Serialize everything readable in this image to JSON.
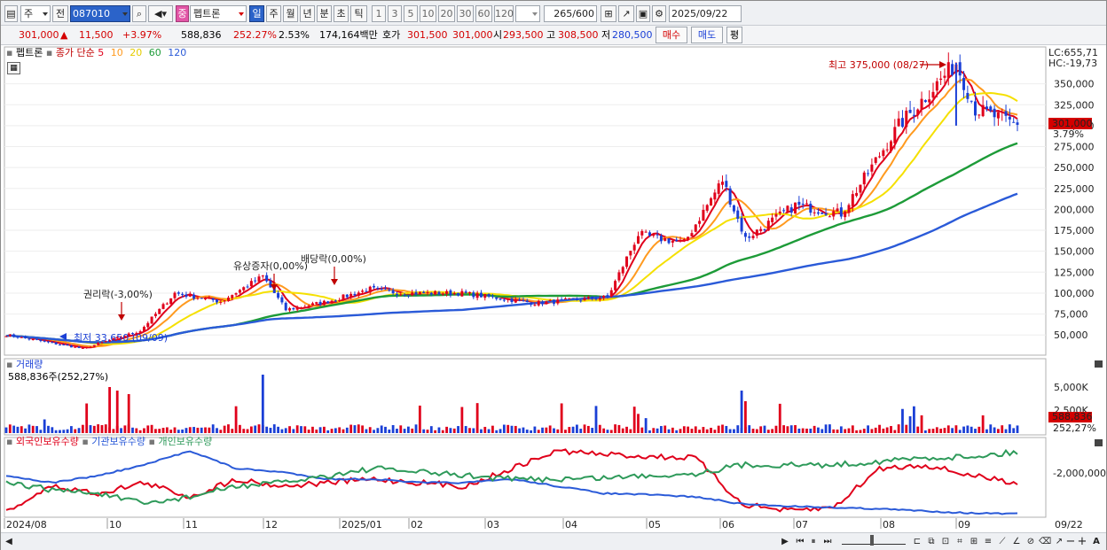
{
  "toolbar": {
    "mode_label": "주",
    "prev_label": "전",
    "stock_code": "087010",
    "stock_badge": "중",
    "stock_name": "펩트론",
    "periods": [
      "일",
      "주",
      "월",
      "년",
      "분",
      "초",
      "틱"
    ],
    "active_period": "일",
    "intervals": [
      "1",
      "3",
      "5",
      "10",
      "20",
      "30",
      "60",
      "120"
    ],
    "count_value": "265",
    "count_total": "/600",
    "date_value": "2025/09/22"
  },
  "quote": {
    "price": "301,000",
    "change_arrow": "▲",
    "change": "11,500",
    "change_pct": "+3.97%",
    "volume": "588,836",
    "volume_ratio": "252.27%",
    "turnover": "2.53%",
    "amount": "174,164백만",
    "ask_label": "호가",
    "ask1": "301,500",
    "ask2": "301,000",
    "open_label": "시",
    "open": "293,500",
    "high_label": "고",
    "high": "308,500",
    "low_label": "저",
    "low": "280,500",
    "buy_label": "매수",
    "sell_label": "매도",
    "eval_label": "평"
  },
  "price_panel": {
    "legend_name": "펩트론",
    "legend_ma_title": "종가 단순",
    "ma_periods": [
      "5",
      "10",
      "20",
      "60",
      "120"
    ],
    "ma_colors": [
      "#e0001b",
      "#ff9a1f",
      "#f5e000",
      "#1d9b38",
      "#2a5ad8"
    ],
    "lc_label": "LC:655,71",
    "hc_label": "HC:-19,73",
    "current_tag": "301,000",
    "current_pct": "3.79%",
    "high_note": "최고 375,000 (08/27)",
    "low_note": "최저 33,650 (09/09)",
    "events": [
      "권리락(-3,00%)",
      "유상증자(0,00%)",
      "배당락(0,00%)"
    ],
    "y_ticks": [
      "350,000",
      "325,000",
      "300,000",
      "275,000",
      "250,000",
      "225,000",
      "200,000",
      "175,000",
      "150,000",
      "125,000",
      "100,000",
      "75,000",
      "50,000"
    ]
  },
  "volume_panel": {
    "title": "거래량",
    "subtitle": "588,836주(252,27%)",
    "y_ticks": [
      "5,000K",
      "2,500K"
    ],
    "current_tag": "588,836",
    "current_pct": "252,27%"
  },
  "holdings_panel": {
    "series_labels": [
      "외국인보유수량",
      "기관보유수량",
      "개인보유수량"
    ],
    "series_colors": [
      "#e0001b",
      "#2a5ad8",
      "#2e9a5a"
    ],
    "y_tick": "-2,000,000"
  },
  "x_axis": {
    "labels": [
      "2024/08",
      "10",
      "11",
      "12",
      "2025/01",
      "02",
      "03",
      "04",
      "05",
      "06",
      "07",
      "08",
      "09"
    ],
    "last_label": "09/22"
  },
  "chart_data": {
    "type": "candlestick",
    "price_axis": {
      "ylim": [
        40000,
        375000
      ]
    },
    "ma_periods": [
      5,
      10,
      20,
      60,
      120
    ],
    "anchors": [
      {
        "date": "2024/08",
        "close": 50000
      },
      {
        "date": "2024/09/09",
        "close": 33650
      },
      {
        "date": "2024/10",
        "close": 55000
      },
      {
        "date": "2024/10 mid",
        "close": 100000
      },
      {
        "date": "2024/11",
        "close": 90000
      },
      {
        "date": "2024/11 mid",
        "close": 120000
      },
      {
        "date": "2024/11 late",
        "close": 80000
      },
      {
        "date": "2024/12",
        "close": 90000
      },
      {
        "date": "2024/12 mid",
        "close": 105000
      },
      {
        "date": "2025/01",
        "close": 100000
      },
      {
        "date": "2025/02",
        "close": 100000
      },
      {
        "date": "2025/03",
        "close": 88000
      },
      {
        "date": "2025/04",
        "close": 95000
      },
      {
        "date": "2025/04 mid",
        "close": 170000
      },
      {
        "date": "2025/05",
        "close": 160000
      },
      {
        "date": "2025/06",
        "close": 235000
      },
      {
        "date": "2025/06 mid",
        "close": 165000
      },
      {
        "date": "2025/07",
        "close": 205000
      },
      {
        "date": "2025/07 late",
        "close": 195000
      },
      {
        "date": "2025/08",
        "close": 300000
      },
      {
        "date": "2025/08/27",
        "close": 375000
      },
      {
        "date": "2025/09",
        "close": 320000
      },
      {
        "date": "2025/09/22",
        "close": 301000
      }
    ]
  }
}
